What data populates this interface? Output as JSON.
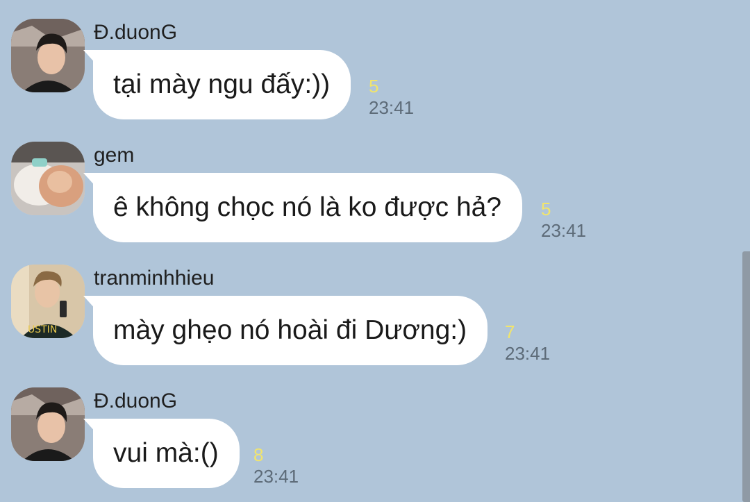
{
  "messages": [
    {
      "sender": "Đ.duonG",
      "text": "tại mày ngu đấy:))",
      "seen_count": "5",
      "time": "23:41",
      "avatar_icon": "user-avatar-dark-hair"
    },
    {
      "sender": "gem",
      "text": "ê không chọc nó là ko được hả?",
      "seen_count": "5",
      "time": "23:41",
      "avatar_icon": "user-avatar-fur-hood"
    },
    {
      "sender": "tranminhhieu",
      "text": "mày ghẹo nó hoài đi Dương:)",
      "seen_count": "7",
      "time": "23:41",
      "avatar_icon": "user-avatar-selfie"
    },
    {
      "sender": "Đ.duonG",
      "text": "vui mà:()",
      "seen_count": "8",
      "time": "23:41",
      "avatar_icon": "user-avatar-dark-hair"
    }
  ],
  "colors": {
    "background": "#b0c5d9",
    "bubble": "#ffffff",
    "seen_count": "#f2e56b",
    "time": "#5d6b78"
  }
}
